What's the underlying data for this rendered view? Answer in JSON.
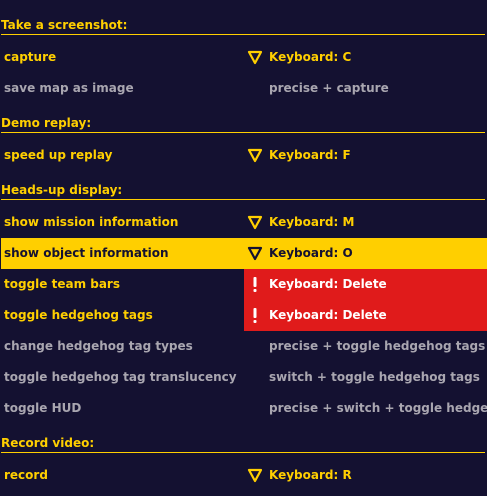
{
  "colors": {
    "background": "#141131",
    "accent": "#ffcf00",
    "muted": "#a9a6b0",
    "conflict": "#e01b1b"
  },
  "sections": {
    "screenshot": {
      "title": "Take a screenshot:",
      "rows": [
        {
          "action": "capture",
          "binding": "Keyboard: C",
          "icon": "triangle-down-icon"
        },
        {
          "action": "save map as image",
          "binding": "precise + capture"
        }
      ]
    },
    "demo": {
      "title": "Demo replay:",
      "rows": [
        {
          "action": "speed up replay",
          "binding": "Keyboard: F",
          "icon": "triangle-down-icon"
        }
      ]
    },
    "hud": {
      "title": "Heads-up display:",
      "rows": [
        {
          "action": "show mission information",
          "binding": "Keyboard: M",
          "icon": "triangle-down-icon"
        },
        {
          "action": "show object information",
          "binding": "Keyboard: O",
          "icon": "triangle-down-icon"
        },
        {
          "action": "toggle team bars",
          "binding": "Keyboard: Delete",
          "icon": "warning-icon"
        },
        {
          "action": "toggle hedgehog tags",
          "binding": "Keyboard: Delete",
          "icon": "warning-icon"
        },
        {
          "action": "change hedgehog tag types",
          "binding": "precise + toggle hedgehog tags"
        },
        {
          "action": "toggle hedgehog tag translucency",
          "binding": "switch + toggle hedgehog tags"
        },
        {
          "action": "toggle HUD",
          "binding": "precise + switch + toggle hedgeh..."
        }
      ]
    },
    "record": {
      "title": "Record video:",
      "rows": [
        {
          "action": "record",
          "binding": "Keyboard: R",
          "icon": "triangle-down-icon"
        }
      ]
    }
  }
}
